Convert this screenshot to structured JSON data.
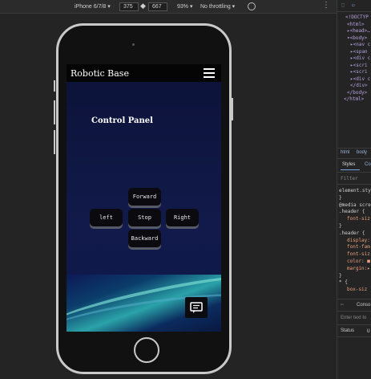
{
  "device_toolbar": {
    "device": "iPhone 6/7/8 ▾",
    "width": "375",
    "height": "667",
    "zoom": "93% ▾",
    "throttle": "No throttling ▾",
    "more": "⋮"
  },
  "app": {
    "brand": "Robotic Base",
    "panel_title": "Control Panel",
    "controls": {
      "forward": "Forward",
      "left": "left",
      "stop": "Stop",
      "right": "Right",
      "backward": "Backward"
    }
  },
  "devtools": {
    "dom_lines": [
      "<!DOCTYP",
      "<html>",
      "▸<head>…",
      "▾<body>",
      "▸<nav c",
      "▸<span",
      "▸<div c",
      "▸<scri",
      "▸<scri",
      "▸<div c",
      "</div>",
      "</body>",
      "</html>"
    ],
    "breadcrumb": [
      "html",
      "body"
    ],
    "tabs": [
      "Styles",
      "Co"
    ],
    "filter": "Filter",
    "style_lines": [
      "element.sty",
      "}",
      "@media scre",
      ".header {",
      "font-siz",
      "}",
      ".header {",
      "display:",
      "font-fam",
      "font-siz",
      "color: ■",
      "margin:▸",
      "}",
      "* {",
      "box-siz"
    ],
    "console_tab": "Conso",
    "console_filter": "Enter text to",
    "status_header": "Status",
    "status_col2": "U"
  }
}
